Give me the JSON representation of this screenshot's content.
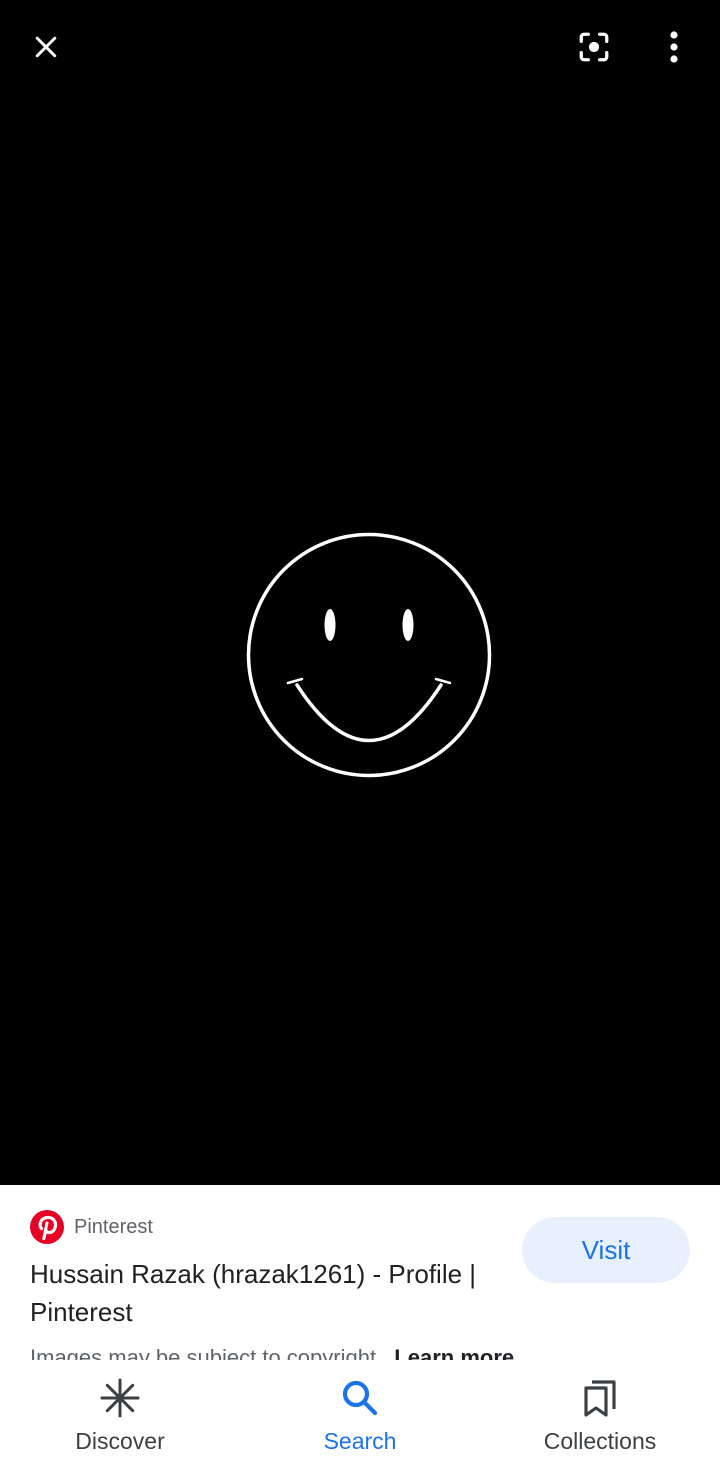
{
  "top_bar": {
    "close_icon": "close-icon",
    "lens_icon": "lens-icon",
    "more_icon": "more-vert-icon"
  },
  "result": {
    "source_name": "Pinterest",
    "source_icon": "pinterest-logo",
    "title": "Hussain Razak (hrazak1261) - Profile | Pinterest",
    "visit_label": "Visit",
    "copyright_text": "Images may be subject to copyright.",
    "learn_more": "Learn more"
  },
  "bottom_nav": {
    "items": [
      {
        "label": "Discover",
        "icon": "discover-asterisk-icon",
        "active": false
      },
      {
        "label": "Search",
        "icon": "search-icon",
        "active": true
      },
      {
        "label": "Collections",
        "icon": "collections-bookmark-icon",
        "active": false
      }
    ]
  },
  "colors": {
    "accent": "#1a73e8",
    "visit_bg": "#e8f0fe",
    "pinterest": "#e60023",
    "viewer_bg": "#000000"
  }
}
